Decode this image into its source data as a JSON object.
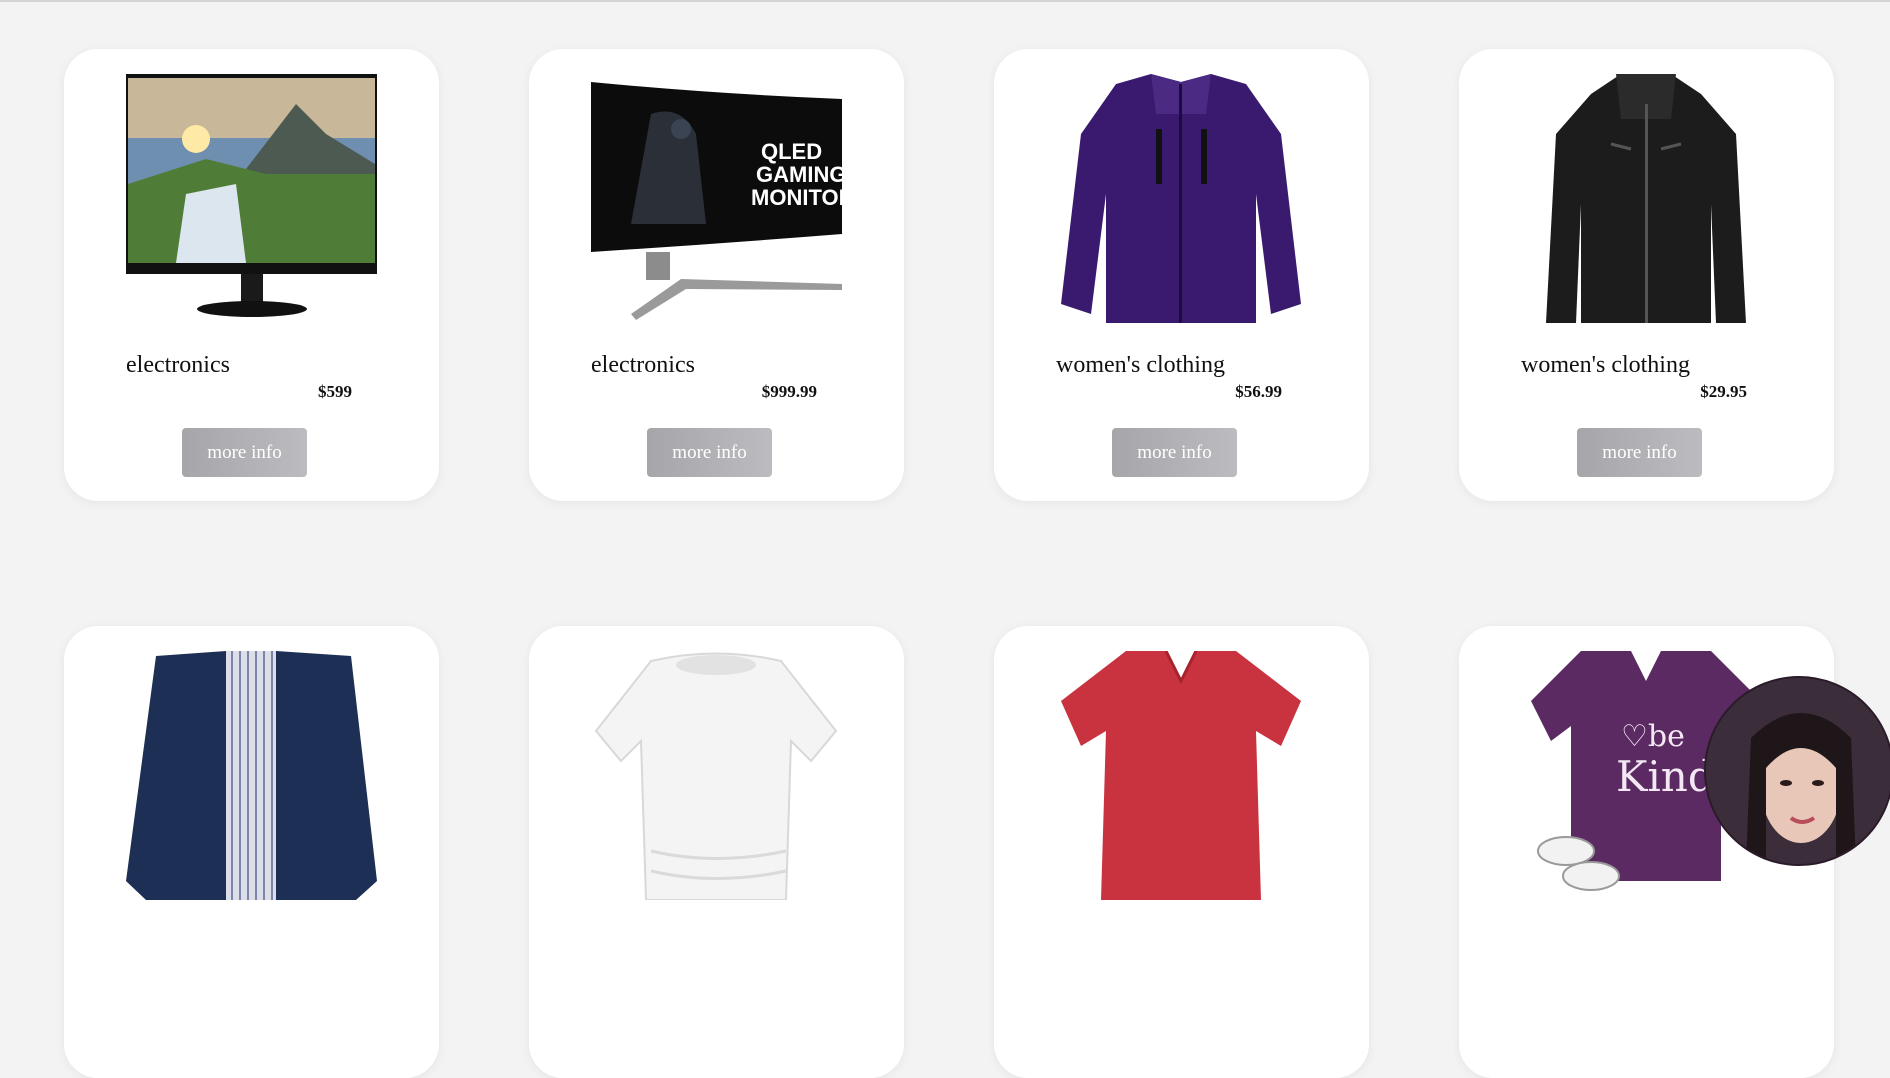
{
  "products": [
    {
      "category": "electronics",
      "price": "$599",
      "button_label": "more info",
      "image_icon": "monitor-landscape-icon"
    },
    {
      "category": "electronics",
      "price": "$999.99",
      "button_label": "more info",
      "image_icon": "curved-gaming-monitor-icon",
      "image_text": [
        "QLED",
        "GAMING",
        "MONITOR"
      ]
    },
    {
      "category": "women's clothing",
      "price": "$56.99",
      "button_label": "more info",
      "image_icon": "purple-jacket-icon"
    },
    {
      "category": "women's clothing",
      "price": "$29.95",
      "button_label": "more info",
      "image_icon": "black-leather-jacket-icon"
    },
    {
      "image_icon": "navy-rain-jacket-icon"
    },
    {
      "image_icon": "white-top-icon"
    },
    {
      "image_icon": "red-tshirt-icon"
    },
    {
      "image_icon": "purple-be-kind-tshirt-icon",
      "image_text": [
        "♡be",
        "Kind"
      ]
    }
  ],
  "colors": {
    "background": "#f3f3f4",
    "card": "#ffffff",
    "button_gradient_start": "#a6a6aa",
    "button_gradient_end": "#bcbcc0"
  },
  "overlay": {
    "icon": "user-webcam-avatar-icon"
  }
}
